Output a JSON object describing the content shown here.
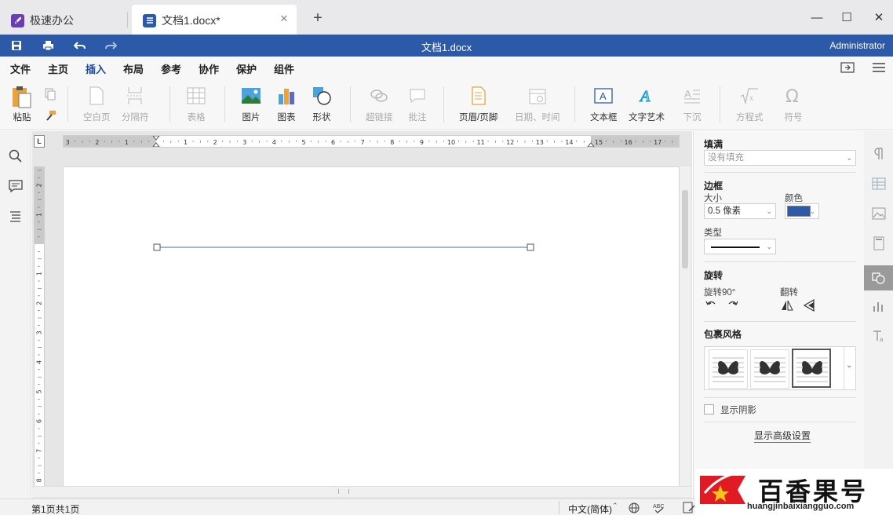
{
  "tabs": {
    "home": {
      "label": "极速办公"
    },
    "doc": {
      "label": "文档1.docx*",
      "close": "✕"
    },
    "new": "+"
  },
  "window": {
    "minimize": "—",
    "maximize": "☐",
    "close": "✕"
  },
  "titlebar": {
    "title": "文档1.docx",
    "user": "Administrator"
  },
  "menu": [
    "文件",
    "主页",
    "插入",
    "布局",
    "参考",
    "协作",
    "保护",
    "组件"
  ],
  "ribbon": {
    "paste": "粘贴",
    "blank_page": "空白页",
    "break": "分隔符",
    "table": "表格",
    "picture": "图片",
    "chart": "图表",
    "shape": "形状",
    "hyperlink": "超链接",
    "comment": "批注",
    "header_footer": "页眉/页脚",
    "date_time": "日期、时间",
    "textbox": "文本框",
    "wordart": "文字艺术",
    "dropcap": "下沉",
    "equation": "方程式",
    "symbol": "符号"
  },
  "panel": {
    "fill_title": "填满",
    "fill_value": "没有填充",
    "border_title": "边框",
    "size_label": "大小",
    "size_value": "0.5 像素",
    "color_label": "颜色",
    "border_color": "#2d5aa8",
    "type_label": "类型",
    "rotate_title": "旋转",
    "rotate90_label": "旋转90°",
    "flip_label": "翻转",
    "wrap_title": "包裹风格",
    "shadow_label": "显示阴影",
    "advanced_label": "显示高级设置"
  },
  "ruler": {
    "h_numbers": [
      "3",
      "2",
      "1",
      "1",
      "2",
      "3",
      "4",
      "5",
      "6",
      "7",
      "8",
      "9",
      "10",
      "11",
      "12",
      "13",
      "14",
      "15",
      "16",
      "17"
    ],
    "v_numbers": [
      "2",
      "1",
      "1",
      "2",
      "3",
      "4",
      "5",
      "6",
      "7",
      "8"
    ]
  },
  "status": {
    "page": "第1页共1页",
    "language": "中文(简体)"
  },
  "watermark": {
    "brand": "百香果号",
    "url": "huangjinbaixiangguo.com"
  },
  "colors": {
    "accent": "#2d5aa8",
    "titlebar": "#2d5aa8"
  }
}
